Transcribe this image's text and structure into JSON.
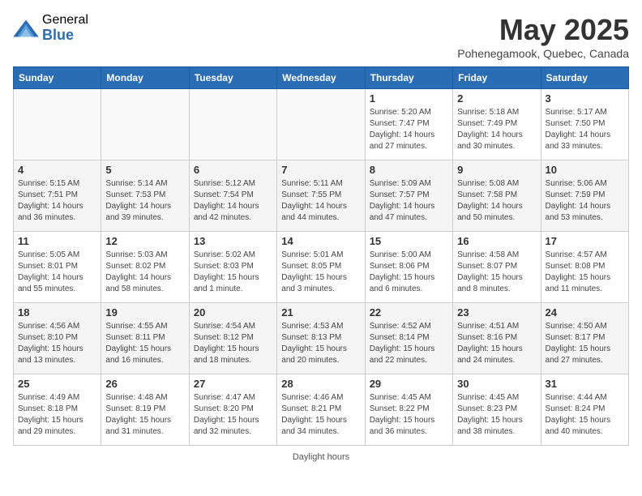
{
  "header": {
    "logo_general": "General",
    "logo_blue": "Blue",
    "month_title": "May 2025",
    "subtitle": "Pohenegamook, Quebec, Canada"
  },
  "weekdays": [
    "Sunday",
    "Monday",
    "Tuesday",
    "Wednesday",
    "Thursday",
    "Friday",
    "Saturday"
  ],
  "weeks": [
    [
      {
        "day": "",
        "info": ""
      },
      {
        "day": "",
        "info": ""
      },
      {
        "day": "",
        "info": ""
      },
      {
        "day": "",
        "info": ""
      },
      {
        "day": "1",
        "info": "Sunrise: 5:20 AM\nSunset: 7:47 PM\nDaylight: 14 hours\nand 27 minutes."
      },
      {
        "day": "2",
        "info": "Sunrise: 5:18 AM\nSunset: 7:49 PM\nDaylight: 14 hours\nand 30 minutes."
      },
      {
        "day": "3",
        "info": "Sunrise: 5:17 AM\nSunset: 7:50 PM\nDaylight: 14 hours\nand 33 minutes."
      }
    ],
    [
      {
        "day": "4",
        "info": "Sunrise: 5:15 AM\nSunset: 7:51 PM\nDaylight: 14 hours\nand 36 minutes."
      },
      {
        "day": "5",
        "info": "Sunrise: 5:14 AM\nSunset: 7:53 PM\nDaylight: 14 hours\nand 39 minutes."
      },
      {
        "day": "6",
        "info": "Sunrise: 5:12 AM\nSunset: 7:54 PM\nDaylight: 14 hours\nand 42 minutes."
      },
      {
        "day": "7",
        "info": "Sunrise: 5:11 AM\nSunset: 7:55 PM\nDaylight: 14 hours\nand 44 minutes."
      },
      {
        "day": "8",
        "info": "Sunrise: 5:09 AM\nSunset: 7:57 PM\nDaylight: 14 hours\nand 47 minutes."
      },
      {
        "day": "9",
        "info": "Sunrise: 5:08 AM\nSunset: 7:58 PM\nDaylight: 14 hours\nand 50 minutes."
      },
      {
        "day": "10",
        "info": "Sunrise: 5:06 AM\nSunset: 7:59 PM\nDaylight: 14 hours\nand 53 minutes."
      }
    ],
    [
      {
        "day": "11",
        "info": "Sunrise: 5:05 AM\nSunset: 8:01 PM\nDaylight: 14 hours\nand 55 minutes."
      },
      {
        "day": "12",
        "info": "Sunrise: 5:03 AM\nSunset: 8:02 PM\nDaylight: 14 hours\nand 58 minutes."
      },
      {
        "day": "13",
        "info": "Sunrise: 5:02 AM\nSunset: 8:03 PM\nDaylight: 15 hours\nand 1 minute."
      },
      {
        "day": "14",
        "info": "Sunrise: 5:01 AM\nSunset: 8:05 PM\nDaylight: 15 hours\nand 3 minutes."
      },
      {
        "day": "15",
        "info": "Sunrise: 5:00 AM\nSunset: 8:06 PM\nDaylight: 15 hours\nand 6 minutes."
      },
      {
        "day": "16",
        "info": "Sunrise: 4:58 AM\nSunset: 8:07 PM\nDaylight: 15 hours\nand 8 minutes."
      },
      {
        "day": "17",
        "info": "Sunrise: 4:57 AM\nSunset: 8:08 PM\nDaylight: 15 hours\nand 11 minutes."
      }
    ],
    [
      {
        "day": "18",
        "info": "Sunrise: 4:56 AM\nSunset: 8:10 PM\nDaylight: 15 hours\nand 13 minutes."
      },
      {
        "day": "19",
        "info": "Sunrise: 4:55 AM\nSunset: 8:11 PM\nDaylight: 15 hours\nand 16 minutes."
      },
      {
        "day": "20",
        "info": "Sunrise: 4:54 AM\nSunset: 8:12 PM\nDaylight: 15 hours\nand 18 minutes."
      },
      {
        "day": "21",
        "info": "Sunrise: 4:53 AM\nSunset: 8:13 PM\nDaylight: 15 hours\nand 20 minutes."
      },
      {
        "day": "22",
        "info": "Sunrise: 4:52 AM\nSunset: 8:14 PM\nDaylight: 15 hours\nand 22 minutes."
      },
      {
        "day": "23",
        "info": "Sunrise: 4:51 AM\nSunset: 8:16 PM\nDaylight: 15 hours\nand 24 minutes."
      },
      {
        "day": "24",
        "info": "Sunrise: 4:50 AM\nSunset: 8:17 PM\nDaylight: 15 hours\nand 27 minutes."
      }
    ],
    [
      {
        "day": "25",
        "info": "Sunrise: 4:49 AM\nSunset: 8:18 PM\nDaylight: 15 hours\nand 29 minutes."
      },
      {
        "day": "26",
        "info": "Sunrise: 4:48 AM\nSunset: 8:19 PM\nDaylight: 15 hours\nand 31 minutes."
      },
      {
        "day": "27",
        "info": "Sunrise: 4:47 AM\nSunset: 8:20 PM\nDaylight: 15 hours\nand 32 minutes."
      },
      {
        "day": "28",
        "info": "Sunrise: 4:46 AM\nSunset: 8:21 PM\nDaylight: 15 hours\nand 34 minutes."
      },
      {
        "day": "29",
        "info": "Sunrise: 4:45 AM\nSunset: 8:22 PM\nDaylight: 15 hours\nand 36 minutes."
      },
      {
        "day": "30",
        "info": "Sunrise: 4:45 AM\nSunset: 8:23 PM\nDaylight: 15 hours\nand 38 minutes."
      },
      {
        "day": "31",
        "info": "Sunrise: 4:44 AM\nSunset: 8:24 PM\nDaylight: 15 hours\nand 40 minutes."
      }
    ]
  ],
  "footer": {
    "daylight_label": "Daylight hours"
  }
}
